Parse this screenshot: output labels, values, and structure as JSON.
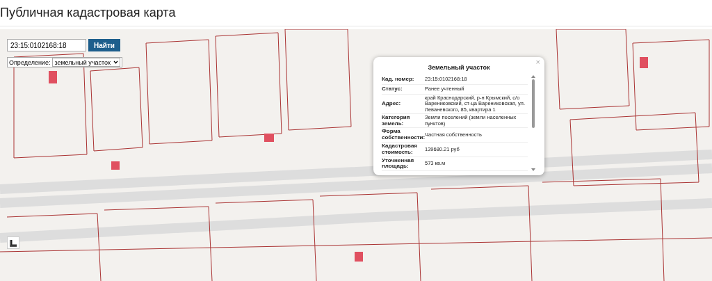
{
  "page": {
    "title": "Публичная кадастровая карта"
  },
  "search": {
    "value": "23:15:0102168:18",
    "button": "Найти"
  },
  "definition": {
    "label": "Определение:",
    "value": "земельный участок"
  },
  "popup": {
    "title": "Земельный участок",
    "close": "×",
    "rows": [
      {
        "label": "Кад. номер:",
        "value": "23:15:0102168:18"
      },
      {
        "label": "Статус:",
        "value": "Ранее учтенный"
      },
      {
        "label": "Адрес:",
        "value": "край Краснодарский, р-н Крымский, с/о Варениковский, ст-ца Варениковская, ул. Леваневского, 85, квартира 1"
      },
      {
        "label": "Категория земель:",
        "value": "Земли поселений (земли населенных пунктов)"
      },
      {
        "label": "Форма собственности:",
        "value": "Частная собственность"
      },
      {
        "label": "Кадастровая стоимость:",
        "value": "139680.21 руб"
      },
      {
        "label": "Уточненная площадь:",
        "value": "573 кв.м"
      }
    ]
  }
}
